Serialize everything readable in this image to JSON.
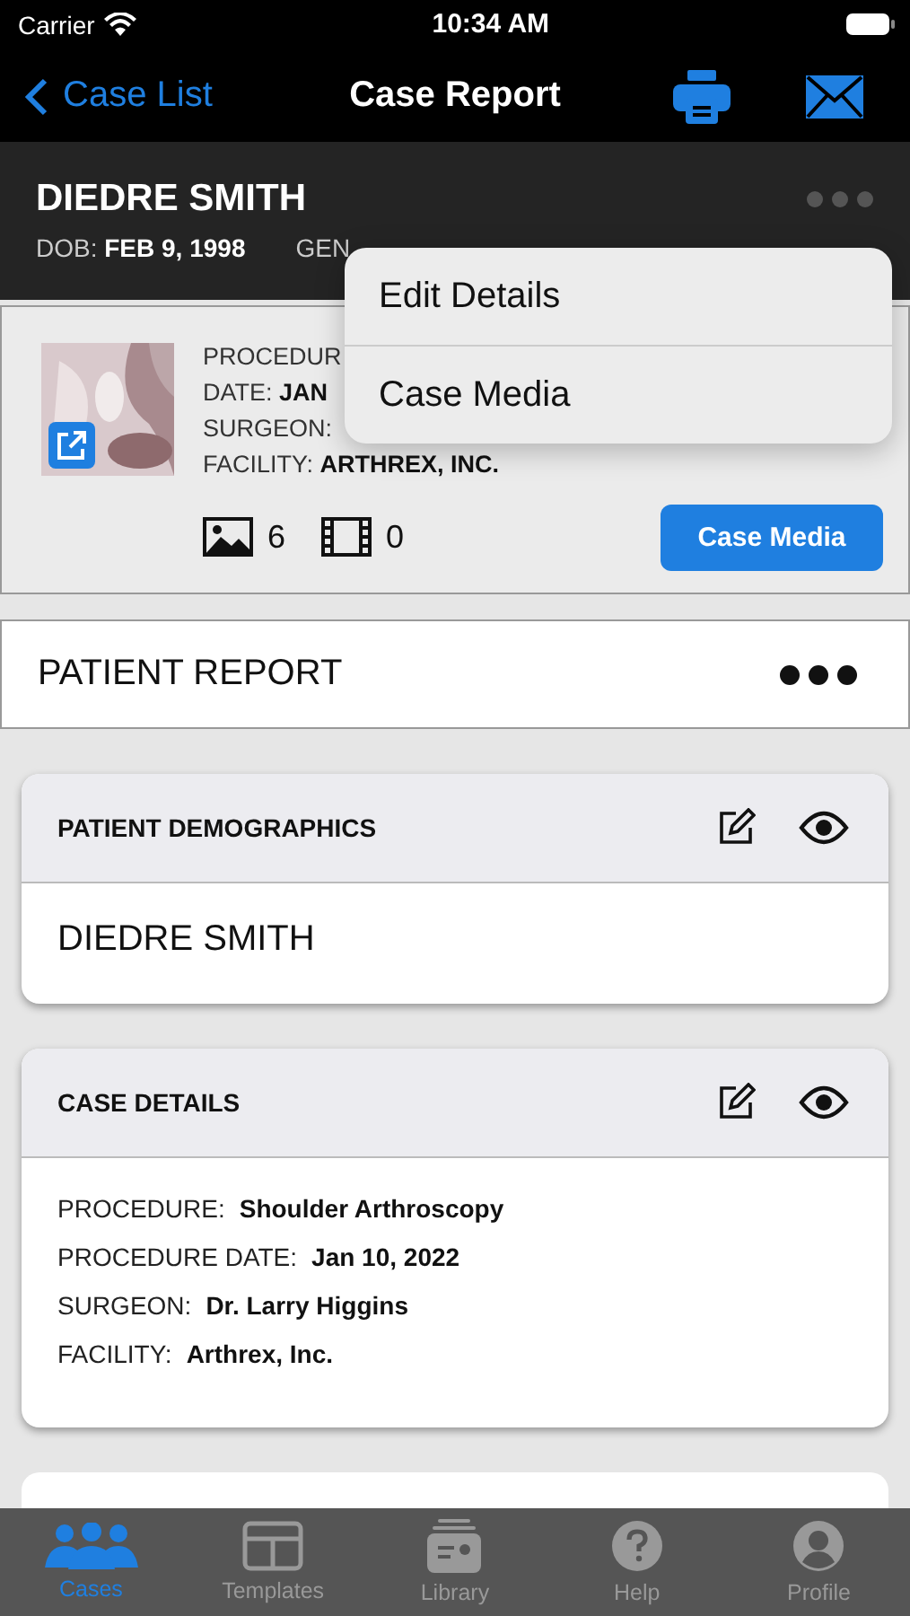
{
  "status_bar": {
    "carrier": "Carrier",
    "time": "10:34 AM"
  },
  "nav": {
    "back": "Case List",
    "title": "Case Report"
  },
  "patient": {
    "name": "DIEDRE SMITH",
    "dob_label": "DOB:",
    "dob": "FEB 9, 1998",
    "gender_label": "GEN"
  },
  "case_summary": {
    "fields": [
      {
        "label": "PROCEDUR"
      },
      {
        "label": "DATE:",
        "value": "JAN"
      },
      {
        "label": "SURGEON:"
      },
      {
        "label": "FACILITY:",
        "value": "ARTHREX, INC."
      }
    ],
    "photo_count": "6",
    "video_count": "0",
    "button": "Case Media"
  },
  "menu": {
    "items": [
      "Edit Details",
      "Case Media"
    ]
  },
  "report": {
    "title": "PATIENT REPORT"
  },
  "sections": [
    {
      "title": "PATIENT DEMOGRAPHICS",
      "kind": "text",
      "text": "DIEDRE SMITH"
    },
    {
      "title": "CASE DETAILS",
      "kind": "fields",
      "fields": [
        {
          "label": "PROCEDURE:",
          "value": "Shoulder Arthroscopy"
        },
        {
          "label": "PROCEDURE DATE:",
          "value": "Jan 10, 2022"
        },
        {
          "label": "SURGEON:",
          "value": "Dr. Larry Higgins"
        },
        {
          "label": "FACILITY:",
          "value": "Arthrex, Inc."
        }
      ]
    }
  ],
  "tab_bar": {
    "items": [
      {
        "label": "Cases",
        "kind": "cases",
        "selected": true
      },
      {
        "label": "Templates",
        "kind": "templates",
        "selected": false
      },
      {
        "label": "Library",
        "kind": "library",
        "selected": false
      },
      {
        "label": "Help",
        "kind": "help",
        "selected": false
      },
      {
        "label": "Profile",
        "kind": "profile",
        "selected": false
      }
    ]
  }
}
